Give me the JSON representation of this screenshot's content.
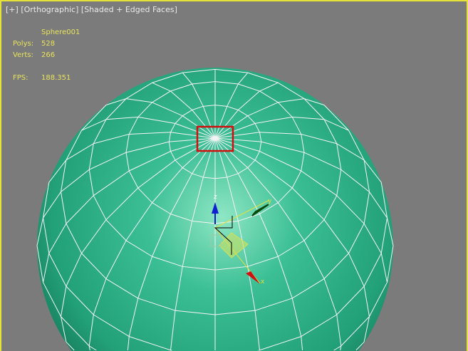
{
  "viewport": {
    "menu_plus": "[+]",
    "view_mode": "[Orthographic]",
    "shading_mode": "[Shaded + Edged Faces]"
  },
  "stats": {
    "object_name": "Sphere001",
    "polys_label": "Polys:",
    "polys_value": "528",
    "verts_label": "Verts:",
    "verts_value": "266",
    "fps_label": "FPS:",
    "fps_value": "188.351"
  },
  "gizmo": {
    "x_label": "x",
    "y_label": "y",
    "z_label": "z"
  },
  "colors": {
    "sphere": "#2aa57e",
    "border": "#e6e23a",
    "selection": "#d01010"
  }
}
